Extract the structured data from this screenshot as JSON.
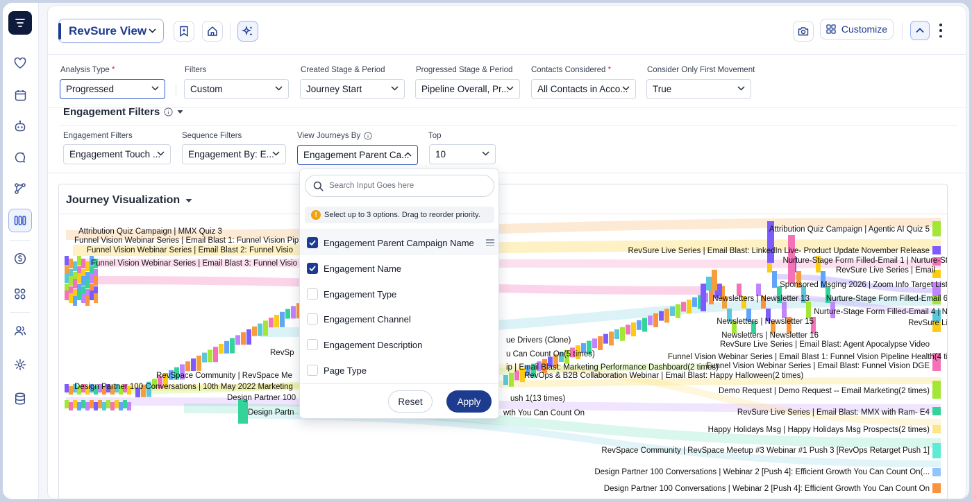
{
  "header": {
    "view_label": "RevSure View",
    "customize_label": "Customize"
  },
  "filters": [
    {
      "label": "Analysis Type",
      "required": true,
      "value": "Progressed"
    },
    {
      "label": "Filters",
      "required": false,
      "value": "Custom"
    },
    {
      "label": "Created Stage & Period",
      "required": false,
      "value": "Journey Start"
    },
    {
      "label": "Progressed Stage & Period",
      "required": false,
      "value": "Pipeline Overall, Pr..."
    },
    {
      "label": "Contacts Considered",
      "required": true,
      "value": "All Contacts in Acco..."
    },
    {
      "label": "Consider Only First Movement",
      "required": false,
      "value": "True"
    }
  ],
  "engagement": {
    "title": "Engagement Filters",
    "fields": [
      {
        "label": "Engagement Filters",
        "value": "Engagement Touch ..."
      },
      {
        "label": "Sequence Filters",
        "value": "Engagement By: E..."
      },
      {
        "label": "View Journeys By",
        "value": "Engagement Parent Ca..."
      },
      {
        "label": "Top",
        "value": "10"
      }
    ]
  },
  "visualization": {
    "title": "Journey Visualization"
  },
  "dropdown": {
    "search_placeholder": "Search Input Goes here",
    "note": "Select up to 3 options. Drag to reorder priority.",
    "options": [
      {
        "label": "Engagement Parent Campaign Name",
        "checked": true
      },
      {
        "label": "Engagement Name",
        "checked": true
      },
      {
        "label": "Engagement Type",
        "checked": false
      },
      {
        "label": "Engagement Channel",
        "checked": false
      },
      {
        "label": "Engagement Description",
        "checked": false
      },
      {
        "label": "Page Type",
        "checked": false
      }
    ],
    "reset_label": "Reset",
    "apply_label": "Apply"
  },
  "sankey_labels": {
    "left": [
      "Attribution Quiz Campaign | MMX Quiz 3",
      "Funnel Vision Webinar Series | Email Blast 1: Funnel Vision Pip",
      "Funnel Vision Webinar Series | Email Blast 2: Funnel Visio",
      "Funnel Vision Webinar Series | Email Blast 3: Funnel Visio",
      "Design Partner 100 Conversations | 10th May 2022 Marketing",
      "RevSpace Community | RevSpace Me",
      "RevSp",
      "Design Partner 100",
      "Design Partn"
    ],
    "middle": [
      "ue Drivers (Clone)",
      "u Can Count On(5 times)",
      "ip | Email Blast: Marketing Performance Dashboard(2 times)",
      "RevOps & B2B Collaboration Webinar | Email Blast: Happy Halloween(2 times)",
      "ush 1(13 times)",
      "wth You Can Count On"
    ],
    "right": [
      "Attribution Quiz Campaign | Agentic AI Quiz 5",
      "RevSure Live Series | Email Blast: LinkedIn Live- Product Update November Release",
      "Nurture-Stage Form Filled-Email 1 | Nurture-St",
      "RevSure Live Series | Email",
      "Sponsored Msging 2026 | Zoom Info Target List",
      "Newsletters | Newsletter 13",
      "Nurture-Stage Form Filled-Email 6",
      "Nurture-Stage Form Filled-Email 4 | N",
      "RevSure Li",
      "Newsletters | Newsletter 15",
      "Newsletters | Newsletter 16",
      "RevSure Live Series | Email Blast: Agent Apocalypse Video",
      "Funnel Vision Webinar Series | Email Blast 1: Funnel Vision Pipeline Health(4 ti",
      "Funnel Vision Webinar Series | Email Blast: Funnel Vision DGE",
      "Demo Request | Demo Request -- Email Marketing(2 times)",
      "RevSure Live Series | Email Blast: MMX with Ram- E4",
      "Happy Holidays Msg | Happy Holidays Msg Prospects(2 times)",
      "RevSpace Community | RevSpace Meetup #3 Webinar #1 Push 3 [RevOps Retarget Push 1]",
      "Design Partner 100 Conversations | Webinar 2 [Push 4]: Efficient Growth You Can Count On(...",
      "Design Partner 100 Conversations | Webinar 2 [Push 4]: Efficient Growth You Can Count On"
    ]
  },
  "colors": {
    "primary": "#1d3b8f",
    "focus": "#2d55c9",
    "warning": "#f0a30a"
  }
}
